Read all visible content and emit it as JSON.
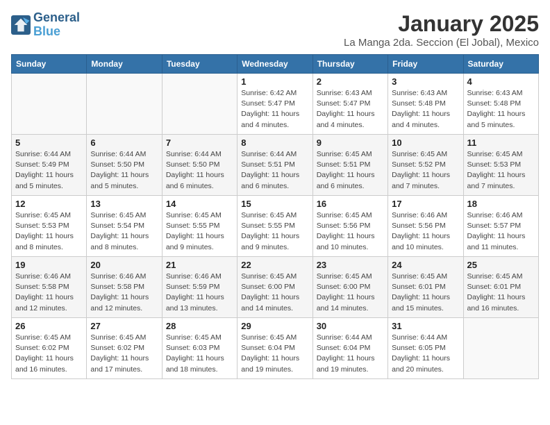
{
  "logo": {
    "line1": "General",
    "line2": "Blue"
  },
  "title": "January 2025",
  "location": "La Manga 2da. Seccion (El Jobal), Mexico",
  "headers": [
    "Sunday",
    "Monday",
    "Tuesday",
    "Wednesday",
    "Thursday",
    "Friday",
    "Saturday"
  ],
  "weeks": [
    [
      {
        "day": "",
        "detail": ""
      },
      {
        "day": "",
        "detail": ""
      },
      {
        "day": "",
        "detail": ""
      },
      {
        "day": "1",
        "detail": "Sunrise: 6:42 AM\nSunset: 5:47 PM\nDaylight: 11 hours and 4 minutes."
      },
      {
        "day": "2",
        "detail": "Sunrise: 6:43 AM\nSunset: 5:47 PM\nDaylight: 11 hours and 4 minutes."
      },
      {
        "day": "3",
        "detail": "Sunrise: 6:43 AM\nSunset: 5:48 PM\nDaylight: 11 hours and 4 minutes."
      },
      {
        "day": "4",
        "detail": "Sunrise: 6:43 AM\nSunset: 5:48 PM\nDaylight: 11 hours and 5 minutes."
      }
    ],
    [
      {
        "day": "5",
        "detail": "Sunrise: 6:44 AM\nSunset: 5:49 PM\nDaylight: 11 hours and 5 minutes."
      },
      {
        "day": "6",
        "detail": "Sunrise: 6:44 AM\nSunset: 5:50 PM\nDaylight: 11 hours and 5 minutes."
      },
      {
        "day": "7",
        "detail": "Sunrise: 6:44 AM\nSunset: 5:50 PM\nDaylight: 11 hours and 6 minutes."
      },
      {
        "day": "8",
        "detail": "Sunrise: 6:44 AM\nSunset: 5:51 PM\nDaylight: 11 hours and 6 minutes."
      },
      {
        "day": "9",
        "detail": "Sunrise: 6:45 AM\nSunset: 5:51 PM\nDaylight: 11 hours and 6 minutes."
      },
      {
        "day": "10",
        "detail": "Sunrise: 6:45 AM\nSunset: 5:52 PM\nDaylight: 11 hours and 7 minutes."
      },
      {
        "day": "11",
        "detail": "Sunrise: 6:45 AM\nSunset: 5:53 PM\nDaylight: 11 hours and 7 minutes."
      }
    ],
    [
      {
        "day": "12",
        "detail": "Sunrise: 6:45 AM\nSunset: 5:53 PM\nDaylight: 11 hours and 8 minutes."
      },
      {
        "day": "13",
        "detail": "Sunrise: 6:45 AM\nSunset: 5:54 PM\nDaylight: 11 hours and 8 minutes."
      },
      {
        "day": "14",
        "detail": "Sunrise: 6:45 AM\nSunset: 5:55 PM\nDaylight: 11 hours and 9 minutes."
      },
      {
        "day": "15",
        "detail": "Sunrise: 6:45 AM\nSunset: 5:55 PM\nDaylight: 11 hours and 9 minutes."
      },
      {
        "day": "16",
        "detail": "Sunrise: 6:45 AM\nSunset: 5:56 PM\nDaylight: 11 hours and 10 minutes."
      },
      {
        "day": "17",
        "detail": "Sunrise: 6:46 AM\nSunset: 5:56 PM\nDaylight: 11 hours and 10 minutes."
      },
      {
        "day": "18",
        "detail": "Sunrise: 6:46 AM\nSunset: 5:57 PM\nDaylight: 11 hours and 11 minutes."
      }
    ],
    [
      {
        "day": "19",
        "detail": "Sunrise: 6:46 AM\nSunset: 5:58 PM\nDaylight: 11 hours and 12 minutes."
      },
      {
        "day": "20",
        "detail": "Sunrise: 6:46 AM\nSunset: 5:58 PM\nDaylight: 11 hours and 12 minutes."
      },
      {
        "day": "21",
        "detail": "Sunrise: 6:46 AM\nSunset: 5:59 PM\nDaylight: 11 hours and 13 minutes."
      },
      {
        "day": "22",
        "detail": "Sunrise: 6:45 AM\nSunset: 6:00 PM\nDaylight: 11 hours and 14 minutes."
      },
      {
        "day": "23",
        "detail": "Sunrise: 6:45 AM\nSunset: 6:00 PM\nDaylight: 11 hours and 14 minutes."
      },
      {
        "day": "24",
        "detail": "Sunrise: 6:45 AM\nSunset: 6:01 PM\nDaylight: 11 hours and 15 minutes."
      },
      {
        "day": "25",
        "detail": "Sunrise: 6:45 AM\nSunset: 6:01 PM\nDaylight: 11 hours and 16 minutes."
      }
    ],
    [
      {
        "day": "26",
        "detail": "Sunrise: 6:45 AM\nSunset: 6:02 PM\nDaylight: 11 hours and 16 minutes."
      },
      {
        "day": "27",
        "detail": "Sunrise: 6:45 AM\nSunset: 6:02 PM\nDaylight: 11 hours and 17 minutes."
      },
      {
        "day": "28",
        "detail": "Sunrise: 6:45 AM\nSunset: 6:03 PM\nDaylight: 11 hours and 18 minutes."
      },
      {
        "day": "29",
        "detail": "Sunrise: 6:45 AM\nSunset: 6:04 PM\nDaylight: 11 hours and 19 minutes."
      },
      {
        "day": "30",
        "detail": "Sunrise: 6:44 AM\nSunset: 6:04 PM\nDaylight: 11 hours and 19 minutes."
      },
      {
        "day": "31",
        "detail": "Sunrise: 6:44 AM\nSunset: 6:05 PM\nDaylight: 11 hours and 20 minutes."
      },
      {
        "day": "",
        "detail": ""
      }
    ]
  ]
}
